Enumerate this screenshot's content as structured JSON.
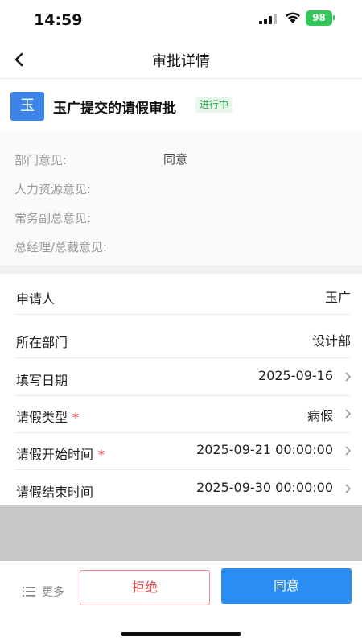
{
  "status_bar": {
    "time": "14:59",
    "battery": "98"
  },
  "nav": {
    "title": "审批详情"
  },
  "header": {
    "avatar_text": "玉",
    "title": "玉广提交的请假审批",
    "status": "进行中"
  },
  "opinions": [
    {
      "label": "部门意见:",
      "value": "同意"
    },
    {
      "label": "人力资源意见:",
      "value": ""
    },
    {
      "label": "常务副总意见:",
      "value": ""
    },
    {
      "label": "总经理/总裁意见:",
      "value": ""
    }
  ],
  "form": [
    {
      "label": "申请人",
      "value": "玉广",
      "required": "",
      "has_chevron": false
    },
    {
      "label": "所在部门",
      "value": "设计部",
      "required": "",
      "has_chevron": false
    },
    {
      "label": "填写日期",
      "value": "2025-09-16",
      "required": "",
      "has_chevron": true
    },
    {
      "label": "请假类型",
      "value": "病假",
      "required": "*",
      "has_chevron": true
    },
    {
      "label": "请假开始时间",
      "value": "2025-09-21 00:00:00",
      "required": "*",
      "has_chevron": true
    },
    {
      "label": "请假结束时间",
      "value": "2025-09-30 00:00:00",
      "required": "",
      "has_chevron": true
    }
  ],
  "actions": {
    "more": "更多",
    "reject": "拒绝",
    "approve": "同意"
  },
  "colors": {
    "accent": "#2b8df0",
    "reject": "#e24c4c",
    "status_green": "#2ca24c",
    "battery": "#33c659"
  }
}
